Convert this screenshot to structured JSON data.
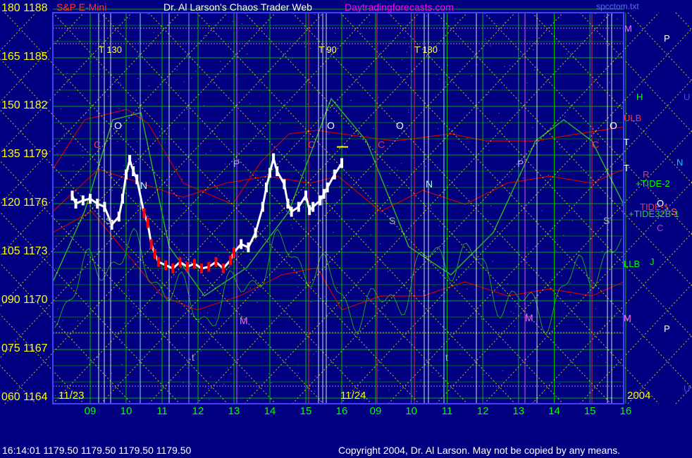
{
  "header": {
    "symbol": "S&P E-Mini",
    "title": "Dr. Al Larson's Chaos Trader Web",
    "site": "Daytradingforecasts.com",
    "file": "spcctom.txt"
  },
  "footer": {
    "quote": "16:14:01  1179.50 1179.50 1179.50 1179.50",
    "copyright": "Copyright 2004, Dr. Al Larson. May not be copied by any means."
  },
  "colors": {
    "background": "#000080",
    "grid_green": "#00cc00",
    "price_white": "#ffffff",
    "price_red": "#ff0000",
    "cycle_yellow": "#ffff00",
    "band_red": "#cc0000",
    "tide_green": "#33aa33"
  },
  "chart_data": {
    "type": "line",
    "y_axis_left": {
      "degrees": [
        "180",
        "165",
        "150",
        "135",
        "120",
        "105",
        "090",
        "075",
        "060"
      ],
      "prices": [
        "1188",
        "1185",
        "1182",
        "1179",
        "1176",
        "1173",
        "1170",
        "1167",
        "1164"
      ],
      "ylim": [
        1164,
        1188
      ]
    },
    "x_axis": {
      "day_labels": [
        "11/23",
        "11/24"
      ],
      "hour_labels": [
        "09",
        "10",
        "11",
        "12",
        "13",
        "14",
        "15",
        "16",
        "09",
        "10",
        "11",
        "12",
        "13",
        "14",
        "15",
        "16"
      ],
      "year": "2004"
    },
    "markers": [
      "T 130",
      "T 90",
      "T 180"
    ],
    "right_labels": [
      "M",
      "P",
      "H",
      "U",
      "ULB",
      "T",
      "T",
      "N",
      "R",
      "+TIDE-2",
      "TIDE-1",
      "O",
      "+TIDE32B-1",
      "S",
      "C",
      "LLB",
      "J",
      "M",
      "P",
      "U"
    ],
    "chart_letters": [
      "O",
      "C",
      "N",
      "S",
      "O",
      "C",
      "P",
      "O",
      "C",
      "N",
      "S",
      "P",
      "O",
      "C",
      "S",
      "M",
      "M",
      "t",
      "t",
      "t"
    ],
    "price_series": {
      "name": "S&P E-Mini",
      "x_hours": [
        8.5,
        8.6,
        8.8,
        9.0,
        9.2,
        9.4,
        9.6,
        9.8,
        9.9,
        10.0,
        10.1,
        10.2,
        10.3,
        10.5,
        10.6,
        10.7,
        10.8,
        10.9,
        11.1,
        11.3,
        11.5,
        11.7,
        11.9,
        12.1,
        12.3,
        12.5,
        12.7,
        12.9,
        13.0,
        13.2,
        13.4,
        13.6,
        13.8,
        13.9,
        14.0,
        14.1,
        14.2,
        14.4,
        14.5,
        14.6,
        14.8,
        15.0,
        15.1,
        15.2,
        15.4,
        15.5,
        15.6,
        15.8,
        16.0
      ],
      "values": [
        1176.5,
        1176.0,
        1176.2,
        1176.3,
        1176.0,
        1175.8,
        1174.7,
        1175.2,
        1176.3,
        1177.8,
        1178.7,
        1178.0,
        1177.5,
        1175.4,
        1174.8,
        1173.5,
        1172.9,
        1172.4,
        1172.2,
        1172.0,
        1172.4,
        1172.1,
        1172.3,
        1172.0,
        1172.1,
        1172.4,
        1172.0,
        1172.5,
        1173.0,
        1173.5,
        1173.3,
        1174.2,
        1175.8,
        1177.0,
        1177.9,
        1178.8,
        1178.0,
        1177.2,
        1176.0,
        1175.5,
        1175.8,
        1176.5,
        1175.6,
        1175.8,
        1176.2,
        1176.6,
        1177.0,
        1177.8,
        1178.5
      ],
      "last": 1179.5
    }
  }
}
